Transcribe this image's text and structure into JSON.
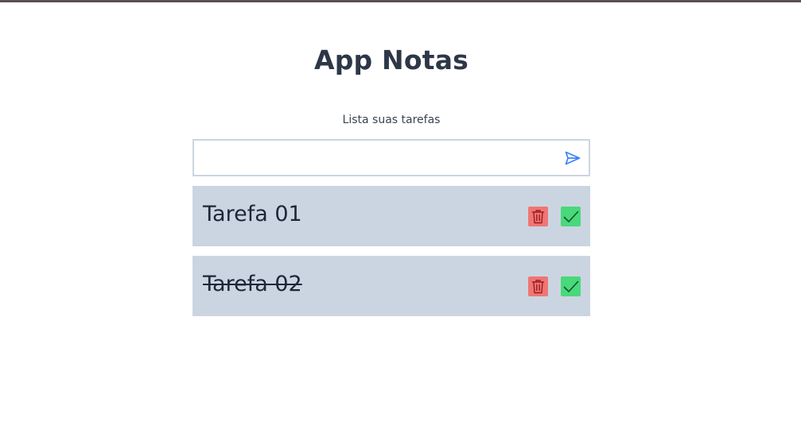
{
  "app": {
    "title": "App Notas",
    "subtitle": "Lista suas tarefas"
  },
  "input": {
    "value": "",
    "placeholder": "",
    "send_icon": "send-icon"
  },
  "tasks": [
    {
      "label": "Tarefa 01",
      "completed": false,
      "delete_icon": "trash-icon",
      "complete_icon": "check-icon"
    },
    {
      "label": "Tarefa 02",
      "completed": true,
      "delete_icon": "trash-icon",
      "complete_icon": "check-icon"
    }
  ],
  "colors": {
    "title": "#2d3748",
    "task_background": "#cbd5e1",
    "delete": "#f07575",
    "complete": "#48d97a",
    "send_icon": "#3b82f6",
    "input_border": "#cbd5e0"
  }
}
